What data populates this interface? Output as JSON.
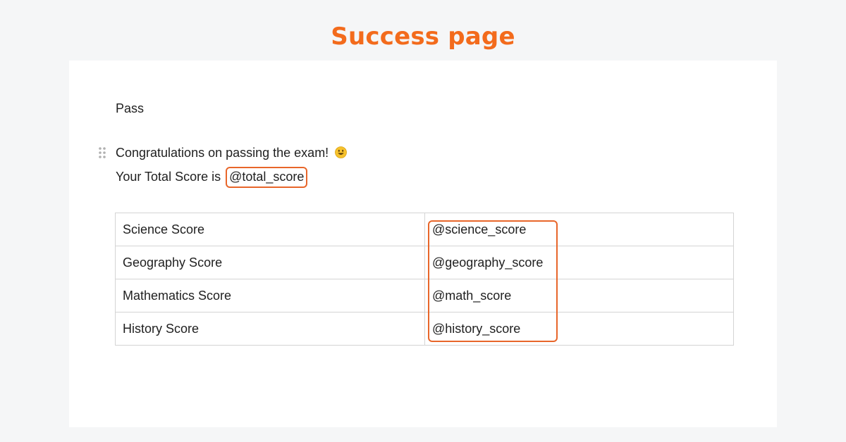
{
  "heading": "Success page",
  "document": {
    "status_text": "Pass",
    "congrats_text": "Congratulations on passing the exam!",
    "congrats_emoji": "smiling-face-icon",
    "total_prefix": "Your Total Score is",
    "total_variable": "@total_score"
  },
  "table": {
    "rows": [
      {
        "label": "Science Score",
        "value": "@science_score"
      },
      {
        "label": "Geography Score",
        "value": "@geography_score"
      },
      {
        "label": "Mathematics Score",
        "value": "@math_score"
      },
      {
        "label": "History Score",
        "value": "@history_score"
      }
    ]
  },
  "colors": {
    "accent": "#f36b1c",
    "highlight_border": "#e8662a",
    "background": "#f5f6f7",
    "card": "#ffffff",
    "table_border": "#d4d4d4"
  }
}
